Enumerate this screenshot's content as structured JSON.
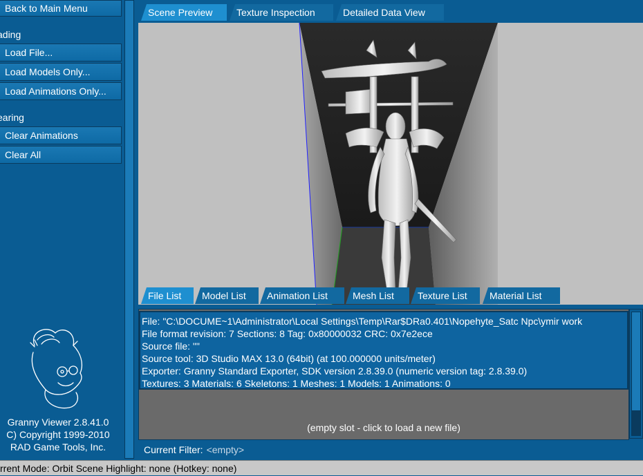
{
  "left_panel": {
    "back_button": "Back to Main Menu",
    "loading_section": "ading",
    "load_file": "Load File...",
    "load_models": "Load Models Only...",
    "load_animations": "Load Animations Only...",
    "clearing_section": "earing",
    "clear_animations": "Clear Animations",
    "clear_all": "Clear All",
    "version": "Granny Viewer 2.8.41.0",
    "copyright": "C) Copyright 1999-2010",
    "company": "RAD Game Tools, Inc."
  },
  "top_tabs": [
    {
      "label": "Scene Preview",
      "active": true
    },
    {
      "label": "Texture Inspection",
      "active": false
    },
    {
      "label": "Detailed Data View",
      "active": false
    }
  ],
  "bottom_tabs": [
    {
      "label": "File List",
      "active": true
    },
    {
      "label": "Model List",
      "active": false
    },
    {
      "label": "Animation List",
      "active": false
    },
    {
      "label": "Mesh List",
      "active": false
    },
    {
      "label": "Texture List",
      "active": false
    },
    {
      "label": "Material List",
      "active": false
    }
  ],
  "file_info": {
    "file": "File: \"C:\\DOCUME~1\\Administrator\\Local Settings\\Temp\\Rar$DRa0.401\\Nopehyte_Satc Npc\\ymir work",
    "format_line": "File format revision: 7    Sections: 8    Tag: 0x80000032    CRC: 0x7e2ece",
    "source_file": "Source file: \"\"",
    "source_tool": "Source tool: 3D Studio MAX 13.0 (64bit) (at 100.000000 units/meter)",
    "exporter": "Exporter: Granny Standard Exporter, SDK version 2.8.39.0 (numeric version tag: 2.8.39.0)",
    "counts": "Textures: 3    Materials: 6    Skeletons: 1    Meshes: 1    Models: 1    Animations: 0"
  },
  "empty_slot": "(empty slot - click to load a new file)",
  "filter": {
    "label": "Current Filter:",
    "value": "<empty>"
  },
  "status_bar": "rrent Mode: Orbit Scene   Highlight: none (Hotkey: none)",
  "colors": {
    "panel_blue": "#0a5c93",
    "button_blue": "#1478b4",
    "active_tab": "#1e8fd0",
    "viewport_gray": "#c0c0c0"
  }
}
